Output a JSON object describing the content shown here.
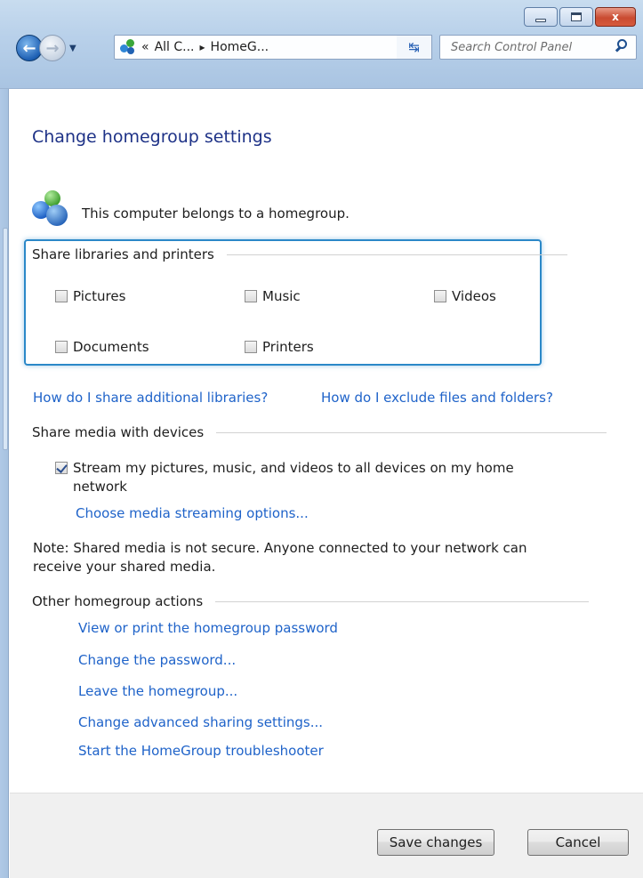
{
  "window": {
    "minimize_label": "",
    "maximize_label": "",
    "close_label": "x"
  },
  "nav": {
    "address_prefix": "«",
    "address_part1": "All C...",
    "address_sep": "▸",
    "address_part2": "HomeG...",
    "search_placeholder": "Search Control Panel"
  },
  "page": {
    "title": "Change homegroup settings",
    "membership_text": "This computer belongs to a homegroup."
  },
  "share_libraries": {
    "heading": "Share libraries and printers",
    "items": [
      {
        "label": "Pictures",
        "checked": false
      },
      {
        "label": "Music",
        "checked": false
      },
      {
        "label": "Videos",
        "checked": false
      },
      {
        "label": "Documents",
        "checked": false
      },
      {
        "label": "Printers",
        "checked": false
      }
    ],
    "link_share_additional": "How do I share additional libraries?",
    "link_exclude": "How do I exclude files and folders?"
  },
  "share_media": {
    "heading": "Share media with devices",
    "stream_label_line1": "Stream my pictures, music, and videos to all devices on my home",
    "stream_label_line2": "network",
    "stream_checked": true,
    "link_streaming_options": "Choose media streaming options...",
    "note_line1": "Note: Shared media is not secure. Anyone connected to your network can",
    "note_line2": "receive your shared media."
  },
  "other_actions": {
    "heading": "Other homegroup actions",
    "links": [
      "View or print the homegroup password",
      "Change the password...",
      "Leave the homegroup...",
      "Change advanced sharing settings...",
      "Start the HomeGroup troubleshooter"
    ]
  },
  "footer": {
    "save_label": "Save changes",
    "cancel_label": "Cancel"
  }
}
